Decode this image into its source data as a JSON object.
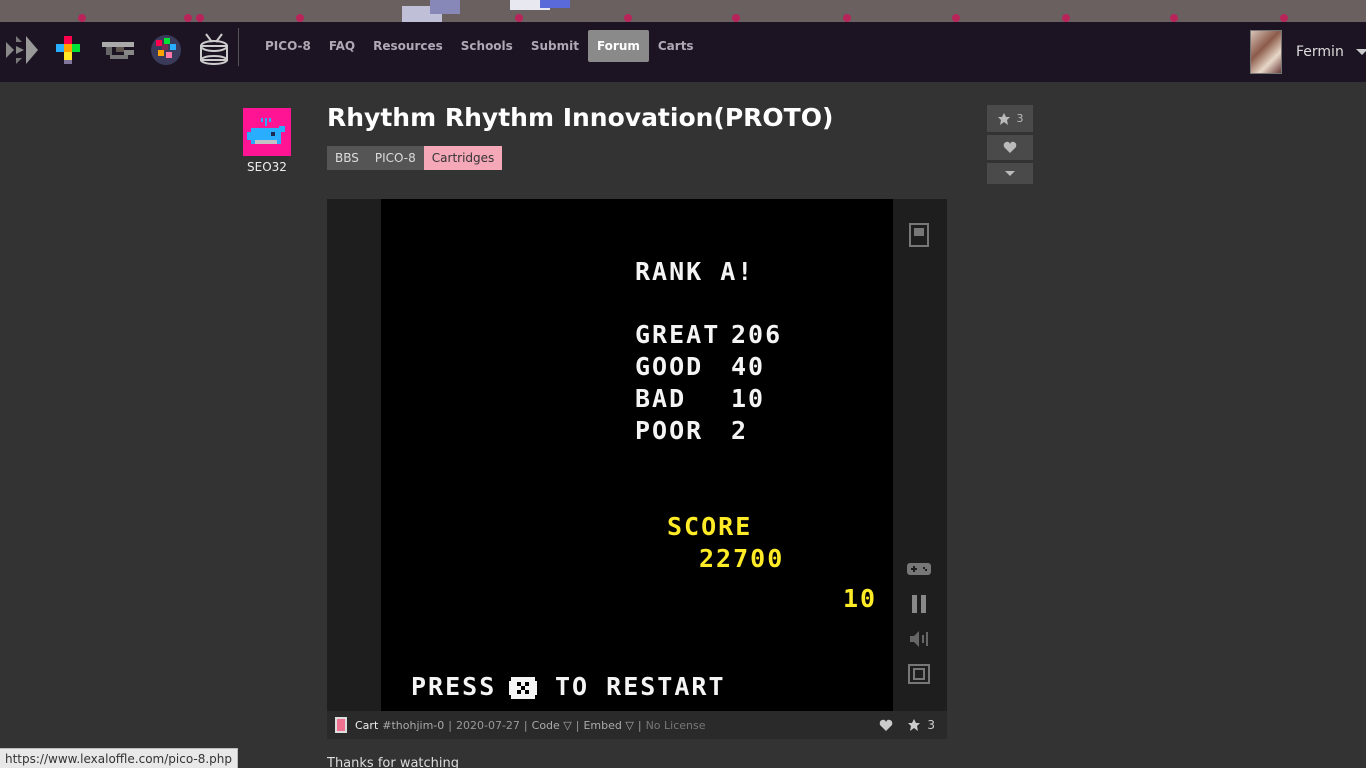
{
  "nav": {
    "icons": [
      "pico8-logo-icon",
      "picotron-icon",
      "voxatron-icon",
      "voxel-icon",
      "drum-icon"
    ],
    "links": [
      {
        "label": "PICO-8",
        "active": false
      },
      {
        "label": "FAQ",
        "active": false
      },
      {
        "label": "Resources",
        "active": false
      },
      {
        "label": "Schools",
        "active": false
      },
      {
        "label": "Submit",
        "active": false
      },
      {
        "label": "Forum",
        "active": true
      },
      {
        "label": "Carts",
        "active": false
      }
    ],
    "user": {
      "name": "Fermin"
    }
  },
  "post": {
    "author": "SEO32",
    "title": "Rhythm Rhythm Innovation(PROTO)",
    "breadcrumbs": [
      "BBS",
      "PICO-8",
      "Cartridges"
    ],
    "stars": "3",
    "body": "Thanks for watching"
  },
  "game": {
    "rank": "RANK A!",
    "stats": [
      {
        "label": "GREAT",
        "value": "206"
      },
      {
        "label": "GOOD",
        "value": "40"
      },
      {
        "label": "BAD",
        "value": "10"
      },
      {
        "label": "POOR",
        "value": "2"
      }
    ],
    "score_label": "SCORE",
    "score_value": "22700",
    "combo": "10",
    "press_text": "PRESS",
    "restart_text": "TO RESTART"
  },
  "cart_footer": {
    "cart_label": "Cart",
    "cart_id": "#thohjim-0",
    "separator": "|",
    "date": "2020-07-27",
    "code": "Code ▽",
    "embed": "Embed ▽",
    "license": "No License",
    "stars": "3"
  },
  "status_bar": {
    "url": "https://www.lexaloffle.com/pico-8.php"
  },
  "colors": {
    "accent_pink": "#f5a8b8",
    "navbar": "#1d1423",
    "pico_yellow": "#ffec27"
  }
}
